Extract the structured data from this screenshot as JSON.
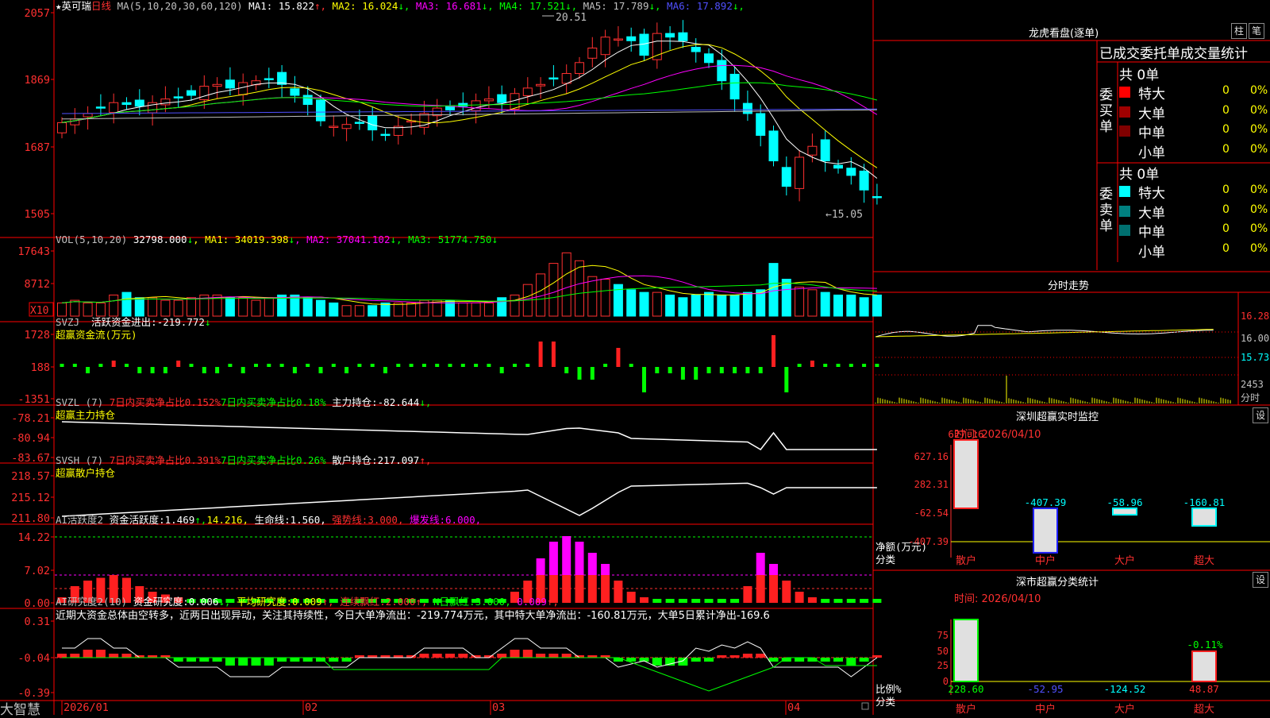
{
  "main": {
    "stock_name": "英可瑞",
    "period": "日线",
    "ma_label": "MA(5,10,20,30,60,120)",
    "ma": [
      {
        "label": "MA1:",
        "value": "15.822",
        "arrow": "↑",
        "color": "#ffffff"
      },
      {
        "label": "MA2:",
        "value": "16.024",
        "arrow": "↓",
        "color": "#ffff00"
      },
      {
        "label": "MA3:",
        "value": "16.681",
        "arrow": "↓",
        "color": "#ff00ff"
      },
      {
        "label": "MA4:",
        "value": "17.521",
        "arrow": "↓",
        "color": "#00ff00"
      },
      {
        "label": "MA5:",
        "value": "17.789",
        "arrow": "↓",
        "color": "#c0c0c0"
      },
      {
        "label": "MA6:",
        "value": "17.892",
        "arrow": "↓",
        "color": "#5050ff"
      }
    ],
    "high_label": "20.51",
    "low_label": "←15.05",
    "y_ticks": [
      "2057",
      "1869",
      "1687",
      "1505"
    ]
  },
  "vol": {
    "title": "VOL(5,10,20)",
    "value": "32798.000",
    "ma": [
      {
        "label": "MA1:",
        "value": "34019.398",
        "arrow": "↓",
        "color": "#ffff00"
      },
      {
        "label": "MA2:",
        "value": "37041.102",
        "arrow": "↓",
        "color": "#ff00ff"
      },
      {
        "label": "MA3:",
        "value": "51774.750",
        "arrow": "↓",
        "color": "#00ff00"
      }
    ],
    "y_ticks": [
      "17643",
      "8712"
    ],
    "unit": "X10"
  },
  "svzj": {
    "title": "SVZJ",
    "label": "活跃资金进出:",
    "value": "-219.772",
    "arrow": "↓",
    "subtitle": "超赢资金流(万元)",
    "y_ticks": [
      "1728",
      "188",
      "-1351"
    ]
  },
  "svzl": {
    "title": "SVZL (7)",
    "t1": "7日内买卖净占比0.152%",
    "t2": "7日内买卖净占比0.18%",
    "t3": "主力持仓:",
    "value": "-82.644",
    "arrow": "↓,",
    "subtitle": "超赢主力持仓",
    "y_ticks": [
      "-78.21",
      "-80.94",
      "-83.67"
    ]
  },
  "svsh": {
    "title": "SVSH (7)",
    "t1": "7日内买卖净占比0.391%",
    "t2": "7日内买卖净占比0.26%",
    "t3": "散户持仓:",
    "value": "217.097",
    "arrow": "↑,",
    "subtitle": "超赢散户持仓",
    "y_ticks": [
      "218.57",
      "215.12",
      "211.80"
    ]
  },
  "ai1": {
    "title": "AI活跃度2",
    "t1": "资金活跃度:",
    "v1": "1.469",
    "v1a": "↑,",
    "v2": "14.216,",
    "t3": "生命线:",
    "v3": "1.560,",
    "t4": "强势线:",
    "v4": "3.000,",
    "t5": "爆发线:",
    "v5": "6.000,",
    "y_ticks": [
      "14.22",
      "7.02",
      "0.00"
    ]
  },
  "ai2": {
    "title": "AI研究度2(10)",
    "t1": "资金研究度:",
    "v1": "0.006",
    "v1a": "↓,",
    "t2": "平均研究度:",
    "v2": "0.009",
    "v2a": "↑,",
    "t3": "连续飘红:",
    "v3": "2.000",
    "v3a": "↑,",
    "t4": "N日飘红:",
    "v4": "3.000,",
    "v5": "0.009",
    "v5a": "↑,",
    "comment": "近期大资金总体由空转多，近两日出现异动，关注其持续性，今日大单净流出：-219.774万元，其中特大单净流出：-160.81万元，大单5日累计净出-169.6",
    "y_ticks": [
      "0.31",
      "-0.04",
      "-0.39"
    ]
  },
  "footer": {
    "brand": "大智慧",
    "dates": [
      "2026/01",
      "02",
      "03",
      "04"
    ]
  },
  "right": {
    "lhb_title": "龙虎看盘(逐单)",
    "btn1": "柱",
    "btn2": "笔",
    "tabs_text": "已成交委托单成交量统计",
    "buy": {
      "side": "委买单",
      "total": "共 0单",
      "rows": [
        {
          "label": "特大",
          "count": "0",
          "pct": "0%",
          "color": "#ff0000"
        },
        {
          "label": "大单",
          "count": "0",
          "pct": "0%",
          "color": "#a00000"
        },
        {
          "label": "中单",
          "count": "0",
          "pct": "0%",
          "color": "#800000"
        },
        {
          "label": "小单",
          "count": "0",
          "pct": "0%",
          "color": "#000000"
        }
      ]
    },
    "sell": {
      "side": "委卖单",
      "total": "共 0单",
      "rows": [
        {
          "label": "特大",
          "count": "0",
          "pct": "0%",
          "color": "#00ffff"
        },
        {
          "label": "大单",
          "count": "0",
          "pct": "0%",
          "color": "#008080"
        },
        {
          "label": "中单",
          "count": "0",
          "pct": "0%",
          "color": "#007070"
        },
        {
          "label": "小单",
          "count": "0",
          "pct": "0%",
          "color": "#000000"
        }
      ]
    },
    "intraday": {
      "title": "分时走势",
      "y1": "16.28",
      "y2": "16.00",
      "y3": "15.73",
      "vol_val": "2453",
      "vol_label": "分时"
    },
    "sz_monitor": {
      "title": "深圳超赢实时监控",
      "set": "设",
      "time": "时间: 2026/04/10",
      "y_ticks": [
        "627.16",
        "282.31",
        "-62.54",
        "-407.39"
      ],
      "ylabel1": "净额(万元)",
      "ylabel2": "分类",
      "bars": [
        {
          "cat": "散户",
          "value": "627.16",
          "color": "#ff2020"
        },
        {
          "cat": "中户",
          "value": "-407.39",
          "color": "#2020ff"
        },
        {
          "cat": "大户",
          "value": "-58.96",
          "color": "#00ffff"
        },
        {
          "cat": "超大",
          "value": "-160.81",
          "color": "#00ffff"
        }
      ]
    },
    "sz_class": {
      "title": "深市超赢分类统计",
      "set": "设",
      "time": "时间: 2026/04/10",
      "y_ticks": [
        "75",
        "50",
        "25",
        "0"
      ],
      "ylabel1": "比例%",
      "ylabel2": "分类",
      "bars": [
        {
          "cat": "散户",
          "value": "228.60",
          "color": "#00ff00"
        },
        {
          "cat": "中户",
          "value": "-52.95",
          "color": "#2020ff"
        },
        {
          "cat": "大户",
          "value": "-124.52",
          "color": "#00ffff"
        },
        {
          "cat": "超大",
          "value": "48.87",
          "color": "#ff2020"
        }
      ],
      "top_label": "-0.11%"
    }
  }
}
